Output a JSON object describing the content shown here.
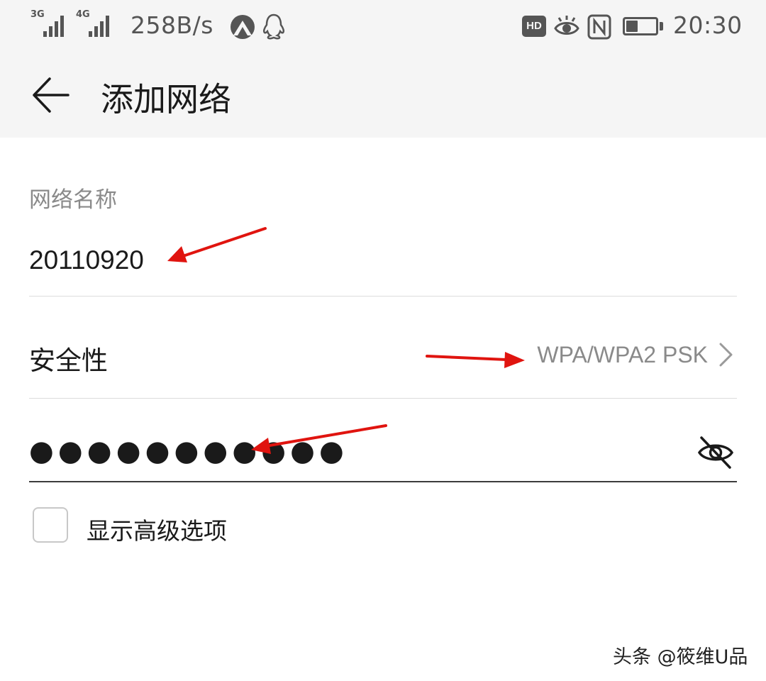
{
  "status_bar": {
    "signal_1_tag": "3G",
    "signal_2_tag": "4G",
    "net_speed": "258B/s",
    "hd_badge": "HD",
    "time": "20:30",
    "icons": [
      "signal-3g-icon",
      "signal-4g-icon",
      "app-notification-icon",
      "qq-icon",
      "hd-icon",
      "eye-comfort-icon",
      "nfc-icon",
      "battery-icon"
    ]
  },
  "header": {
    "title": "添加网络"
  },
  "form": {
    "network_name_label": "网络名称",
    "network_name_value": "20110920",
    "security_label": "安全性",
    "security_value": "WPA/WPA2 PSK",
    "password_value": "●●●●●●●●●●●",
    "advanced_label": "显示高级选项",
    "advanced_checked": false
  },
  "watermark": "头条 @筱维U品",
  "colors": {
    "header_bg": "#f5f5f5",
    "secondary_text": "#8a8a8a",
    "annotation_arrow": "#e0140f"
  }
}
